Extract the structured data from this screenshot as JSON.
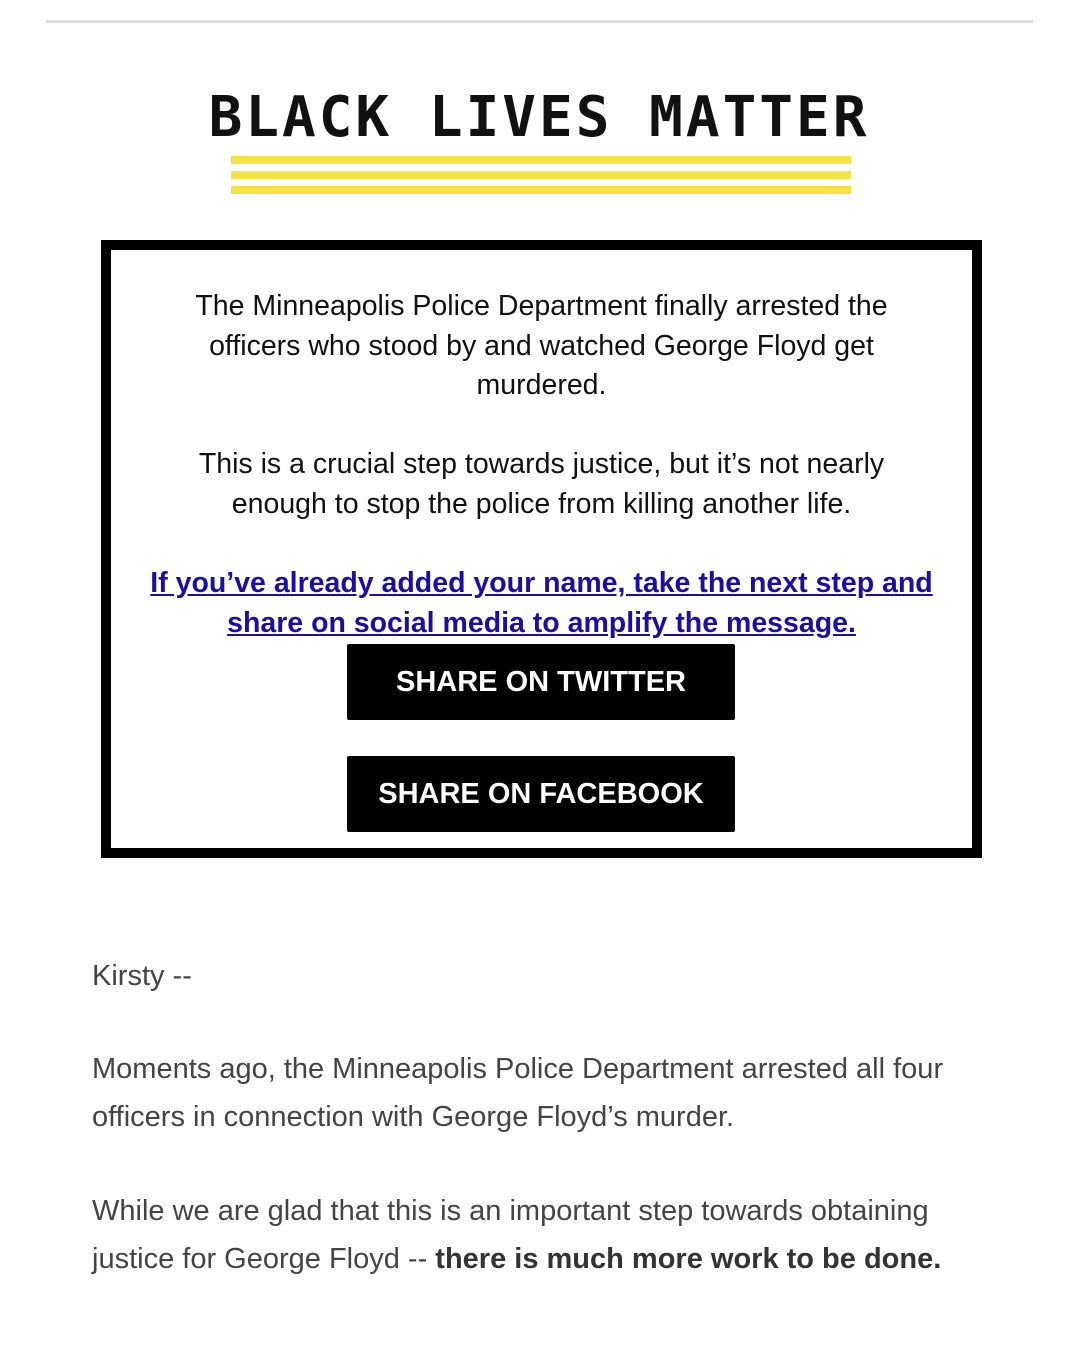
{
  "header": {
    "logo_text": "BLACK LIVES MATTER",
    "logo_name": "Black Lives Matter logo"
  },
  "callout": {
    "paragraph1": "The Minneapolis Police Department finally arrested the officers who stood by and watched George Floyd get murdered.",
    "paragraph2": "This is a crucial step towards justice, but it’s not nearly enough to stop the police from killing another life.",
    "share_link_text": "If you’ve already added your name, take the next step and share on social media to amplify the message.",
    "twitter_button": "SHARE ON TWITTER",
    "facebook_button": "SHARE ON FACEBOOK"
  },
  "body": {
    "greeting": "Kirsty --",
    "paragraph1": "Moments ago, the Minneapolis Police Department arrested all four officers in connection with George Floyd’s murder.",
    "paragraph2_regular": "While we are glad that this is an important step towards obtaining justice for George Floyd -- ",
    "paragraph2_bold": "there is much more work to be done."
  },
  "colors": {
    "logo_stripe": "#f4e340",
    "link": "#1a0dab",
    "box_border": "#000000",
    "button_bg": "#000000",
    "button_text": "#ffffff",
    "body_text": "#444444"
  }
}
